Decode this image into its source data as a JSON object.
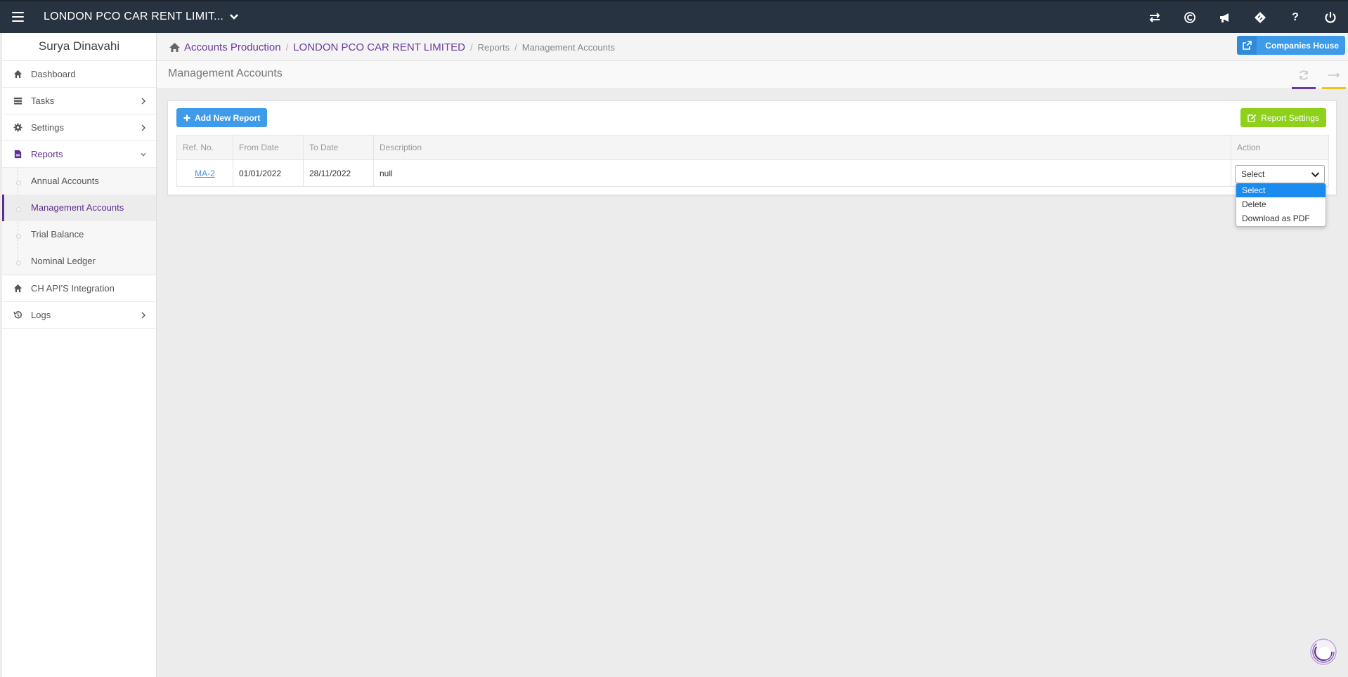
{
  "topbar": {
    "company": "LONDON PCO CAR RENT LIMIT...",
    "icons": [
      "transfer-icon",
      "copyright-icon",
      "bullhorn-icon",
      "ticket-icon",
      "help-icon",
      "power-icon"
    ],
    "help_label": "?"
  },
  "sidebar": {
    "user": "Surya Dinavahi",
    "items": [
      {
        "label": "Dashboard",
        "icon": "home-icon"
      },
      {
        "label": "Tasks",
        "icon": "tasks-icon"
      },
      {
        "label": "Settings",
        "icon": "gear-icon"
      },
      {
        "label": "Reports",
        "icon": "file-icon"
      },
      {
        "label": "CH API'S Integration",
        "icon": "home-icon"
      },
      {
        "label": "Logs",
        "icon": "history-icon"
      }
    ],
    "reports_sub": [
      {
        "label": "Annual Accounts"
      },
      {
        "label": "Management Accounts"
      },
      {
        "label": "Trial Balance"
      },
      {
        "label": "Nominal Ledger"
      }
    ]
  },
  "breadcrumb": {
    "items": [
      "Accounts Production",
      "LONDON PCO CAR RENT LIMITED",
      "Reports",
      "Management Accounts"
    ],
    "companies_house": "Companies House"
  },
  "page": {
    "title": "Management Accounts",
    "tool_colors": {
      "refresh": "#6a3aa0",
      "expand": "#f0c419"
    }
  },
  "panel": {
    "add_button": "Add New Report",
    "settings_button": "Report Settings",
    "columns": [
      "Ref. No.",
      "From Date",
      "To Date",
      "Description",
      "Action"
    ],
    "rows": [
      {
        "ref": "MA-2",
        "from": "01/01/2022",
        "to": "28/11/2022",
        "description": "null",
        "action": "Select"
      }
    ]
  },
  "dropdown": {
    "options": [
      "Select",
      "Delete",
      "Download as PDF"
    ],
    "selected": "Select"
  },
  "colors": {
    "topbar": "#273340",
    "accent": "#5e2e91",
    "primary_button": "#3d9be9",
    "success_button": "#8ed11a"
  }
}
